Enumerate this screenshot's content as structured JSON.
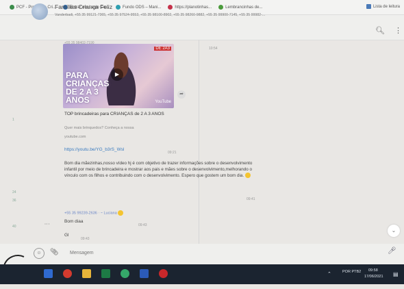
{
  "bookmarks": [
    {
      "label": "PCF - Programa Cri...",
      "color": "#3c8c4b"
    },
    {
      "label": "Entrar em Lagie Co...",
      "color": "#2f6aa8"
    },
    {
      "label": "Fundo ODS – Mani...",
      "color": "#2f9fb0"
    },
    {
      "label": "https://planotinhas...",
      "color": "#c5314a"
    },
    {
      "label": "Lembrancinhas de...",
      "color": "#4b9a3c"
    }
  ],
  "bookmarks_right": "Lista de leitura",
  "chat": {
    "title": "Famílias Criança Feliz",
    "members": "Vanderbadi, +55 35 99121-7365, +55 35 97524-9553, +55 35 98100-8902, +55 35 98260-9882, +55 35 99900-7145, +55 35 99982-...",
    "meta_top": "+55 35 98402-7190",
    "meta_right": "10:54"
  },
  "message1": {
    "thumb_text": "PARA CRIANÇAS DE 2 A 3 ANOS",
    "thumb_tag": "DE 2A3",
    "thumb_logo": "YouTube",
    "video_title": "TOP brincadeiras para CRIANÇAS de 2 A 3 ANOS",
    "video_desc": "Quer mais brinquedos? Conheça a nossa",
    "video_domain": "youtube.com",
    "link": "https://youtu.be/YG_b3rS_Wsl",
    "time": "09:21",
    "body": "Bom dia mãezinhas,nosso vídeo hj é com objetivo de trazer informações sobre o desenvolvimento infantil por meio de brincadeira e mostrar aos pais e mães sobre o desenvolvimento,melhorando o vínculo com os filhos e contribuindo com o desenvolvimento. Espero que gostem um bom dia.",
    "body_time": "09:41"
  },
  "message2": {
    "sender": "+55 35 99239-2636 · ~ Luciana",
    "text": "Bom diaa",
    "time": "09:43"
  },
  "message3": {
    "text": "Gl",
    "time": "09:43"
  },
  "gutter": [
    "1",
    "24",
    "36",
    "40"
  ],
  "compose": {
    "placeholder": "Mensagem"
  },
  "icons": {
    "search": "search-icon",
    "menu": "kebab-menu-icon",
    "emoji": "emoji-icon",
    "attach": "paperclip-icon",
    "mic": "microphone-icon",
    "scroll_down": "chevron-down-icon"
  },
  "taskbar": {
    "apps": [
      {
        "name": "mail",
        "color": "#2f6ad0"
      },
      {
        "name": "chrome",
        "color": "#d33b2f"
      },
      {
        "name": "files",
        "color": "#e7b53a"
      },
      {
        "name": "excel",
        "color": "#1d7a45"
      },
      {
        "name": "whatsapp",
        "color": "#35a86a"
      },
      {
        "name": "word",
        "color": "#2b5bb8"
      },
      {
        "name": "record",
        "color": "#c8282b"
      }
    ],
    "lang": "POR PTB2",
    "time": "09:58",
    "date": "17/06/2021"
  }
}
